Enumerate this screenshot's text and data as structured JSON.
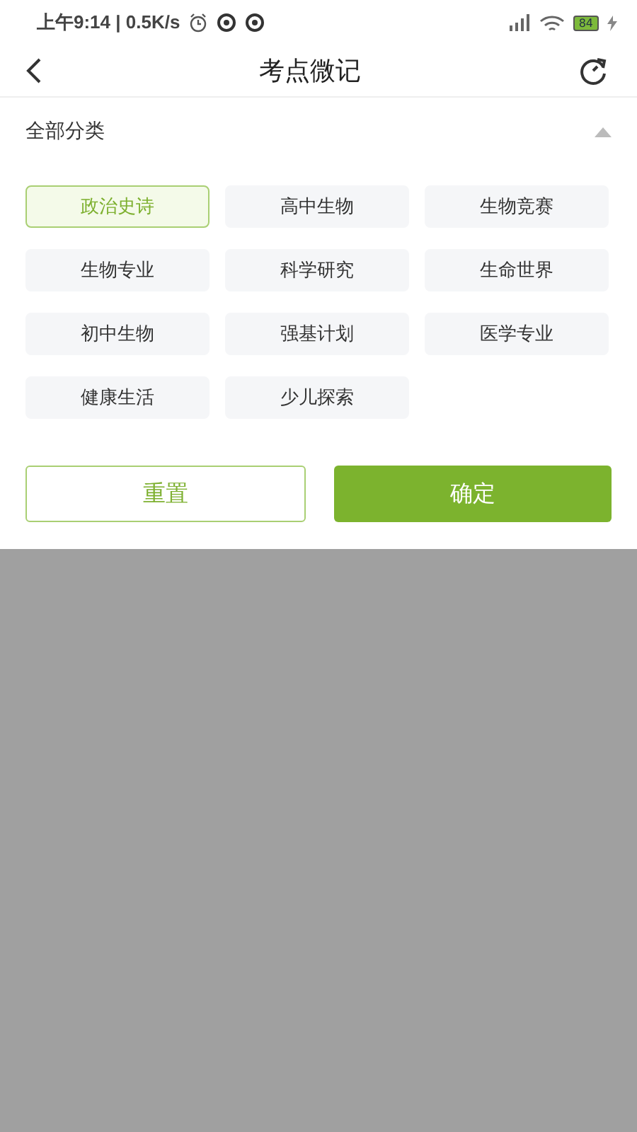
{
  "status_bar": {
    "time": "上午9:14 | 0.5K/s",
    "battery": "84"
  },
  "header": {
    "title": "考点微记"
  },
  "filter": {
    "label": "全部分类",
    "expanded": true
  },
  "categories": [
    {
      "label": "政治史诗",
      "selected": true
    },
    {
      "label": "高中生物",
      "selected": false
    },
    {
      "label": "生物竞赛",
      "selected": false
    },
    {
      "label": "生物专业",
      "selected": false
    },
    {
      "label": "科学研究",
      "selected": false
    },
    {
      "label": "生命世界",
      "selected": false
    },
    {
      "label": "初中生物",
      "selected": false
    },
    {
      "label": "强基计划",
      "selected": false
    },
    {
      "label": "医学专业",
      "selected": false
    },
    {
      "label": "健康生活",
      "selected": false
    },
    {
      "label": "少儿探索",
      "selected": false
    }
  ],
  "buttons": {
    "reset": "重置",
    "confirm": "确定"
  }
}
